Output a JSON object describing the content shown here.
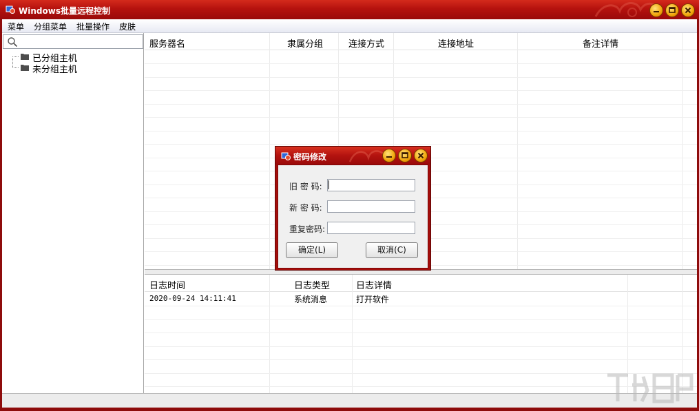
{
  "window": {
    "title": "Windows批量远程控制"
  },
  "menubar": {
    "items": [
      "菜单",
      "分组菜单",
      "批量操作",
      "皮肤"
    ]
  },
  "left_pane": {
    "search_placeholder": "",
    "tree": [
      {
        "label": "已分组主机",
        "icon": "folder-icon"
      },
      {
        "label": "未分组主机",
        "icon": "folder-icon"
      }
    ]
  },
  "server_table": {
    "columns": [
      "服务器名",
      "隶属分组",
      "连接方式",
      "连接地址",
      "备注详情"
    ],
    "rows": []
  },
  "log_table": {
    "columns": [
      "日志时间",
      "日志类型",
      "日志详情"
    ],
    "rows": [
      {
        "time": "2020-09-24 14:11:41",
        "type": "系统消息",
        "detail": "打开软件"
      }
    ]
  },
  "dialog": {
    "title": "密码修改",
    "fields": [
      {
        "label": "旧 密 码:",
        "value": ""
      },
      {
        "label": "新 密 码:",
        "value": ""
      },
      {
        "label": "重复密码:",
        "value": ""
      }
    ],
    "ok_label": "确定(L)",
    "cancel_label": "取消(C)"
  },
  "colors": {
    "titlebar": "#b5120e",
    "window_frame": "#8e0c0c",
    "button_gold": "#f1a50a"
  }
}
